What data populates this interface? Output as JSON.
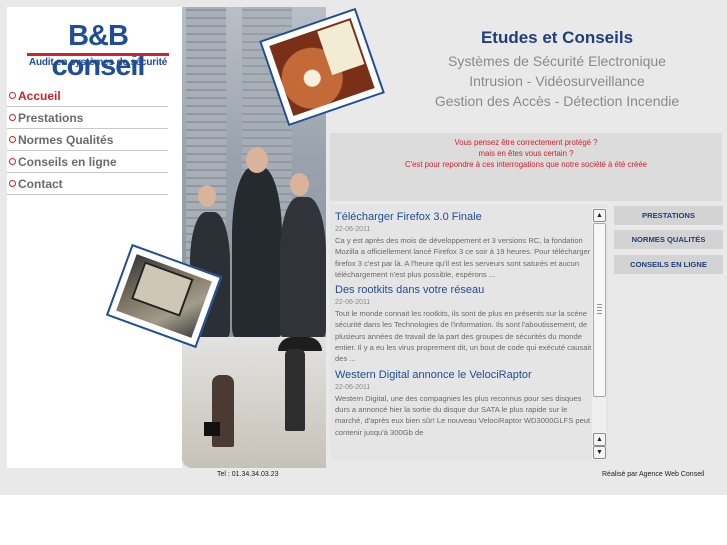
{
  "logo": {
    "title": "B&B conseil",
    "subtitle": "Audit en systèmes de sécurité"
  },
  "nav": {
    "items": [
      {
        "label": "Accueil"
      },
      {
        "label": "Prestations"
      },
      {
        "label": "Normes Qualités"
      },
      {
        "label": "Conseils en ligne"
      },
      {
        "label": "Contact"
      }
    ]
  },
  "header": {
    "title": "Etudes et Conseils",
    "line1": "Systèmes de Sécurité Electronique",
    "line2": "Intrusion - Vidéosurveillance",
    "line3": "Gestion des Accès - Détection Incendie"
  },
  "notice": {
    "line1": "Vous pensez être correctement protégé ?",
    "line2": "mais en êtes vous certain ?",
    "line3": "C'est pour repondre à ces interrogations que notre société à été créée"
  },
  "news": [
    {
      "title": "Télécharger Firefox 3.0 Finale",
      "date": "22-06-2011",
      "body": "Ca y est après des mois de développement et 3 versions RC, la fondation Mozilla a officiellement lancé Firefox 3 ce soir à 19 heures. Pour télécharger firefox 3 c'est par là. A l'heure qu'il est les serveurs sont saturés et aucun téléchargement n'est plus possible, espérons ..."
    },
    {
      "title": "Des rootkits dans votre réseau",
      "date": "22-06-2011",
      "body": "Tout le monde connait les rootkits, ils sont de plus en présents sur la scène sécurité dans les Technologies de l'information. Ils sont l'aboutissement, de plusieurs années de travail de la part des groupes de sécurités du monde entier. Il y a eu les virus proprement dit, un bout de code qui exécuté causait des ..."
    },
    {
      "title": "Western Digital annonce le VelociRaptor",
      "date": "22-06-2011",
      "body": "Western Digital, une des compagnies les plus reconnus pour ses disques durs a annoncé hier la sortie du disque dur SATA le plus rapide sur le marché, d'après eux bien sûr! Le nouveau VelociRaptor WD3000GLFS peut contenir jusqu'à 300Gb de"
    }
  ],
  "right_buttons": {
    "b1": "PRESTATIONS",
    "b2": "NORMES QUALITÉS",
    "b3": "CONSEILS EN LIGNE"
  },
  "footer": {
    "phone": "Tel : 01.34.34.03.23",
    "credit": "Réalisé par Agence Web Conseil"
  },
  "colors": {
    "brand_blue": "#1f4d96",
    "accent_red": "#d3202a",
    "panel_gray": "#e9e9e9"
  }
}
